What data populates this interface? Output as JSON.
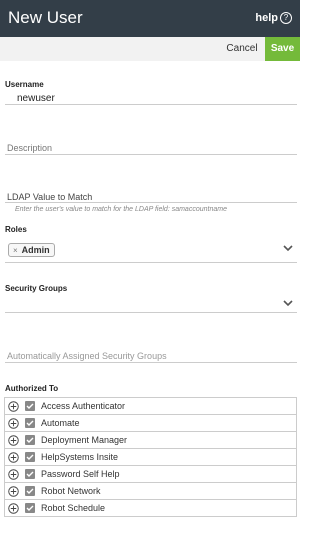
{
  "header": {
    "title": "New User",
    "help_label": "help",
    "help_icon": "question-circle"
  },
  "toolbar": {
    "cancel_label": "Cancel",
    "save_label": "Save",
    "save_color": "#74ba3a"
  },
  "form": {
    "username_label": "Username",
    "username_value": "newuser",
    "description_placeholder": "Description",
    "ldap_placeholder": "LDAP Value to Match",
    "ldap_hint": "Enter the user's value to match for the LDAP field: samaccountname",
    "roles_label": "Roles",
    "roles_selected": [
      "Admin"
    ],
    "security_groups_label": "Security Groups",
    "auto_groups_placeholder": "Automatically Assigned Security Groups",
    "authorized_to_label": "Authorized To"
  },
  "authorized_to": [
    {
      "label": "Access Authenticator",
      "checked": true
    },
    {
      "label": "Automate",
      "checked": true
    },
    {
      "label": "Deployment Manager",
      "checked": true
    },
    {
      "label": "HelpSystems Insite",
      "checked": true
    },
    {
      "label": "Password Self Help",
      "checked": true
    },
    {
      "label": "Robot Network",
      "checked": true
    },
    {
      "label": "Robot Schedule",
      "checked": true
    }
  ],
  "colors": {
    "header_bg": "#333e48",
    "toolbar_bg": "#f2f2f2"
  }
}
